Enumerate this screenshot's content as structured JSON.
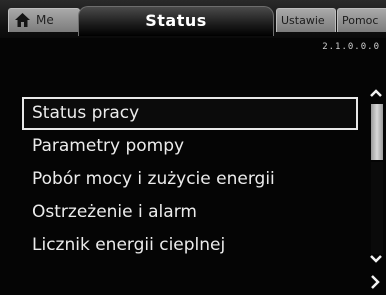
{
  "tabs": {
    "home_label": "Me",
    "status_label": "Status",
    "settings_label": "Ustawie",
    "help_label": "Pomoc"
  },
  "version": "2.1.0.0.0",
  "menu": {
    "items": [
      {
        "label": "Status pracy",
        "selected": true
      },
      {
        "label": "Parametry pompy",
        "selected": false
      },
      {
        "label": "Pobór mocy i zużycie energii",
        "selected": false
      },
      {
        "label": "Ostrzeżenie i alarm",
        "selected": false
      },
      {
        "label": "Licznik energii cieplnej",
        "selected": false
      }
    ]
  },
  "icons": {
    "home": "home-icon",
    "scroll_up": "chevron-up-icon",
    "scroll_down": "chevron-down-icon",
    "next": "chevron-right-icon"
  },
  "colors": {
    "background": "#050505",
    "text": "#ececec",
    "tab_inactive": "#9a9a9a",
    "selection_border": "#e9e9e9"
  }
}
